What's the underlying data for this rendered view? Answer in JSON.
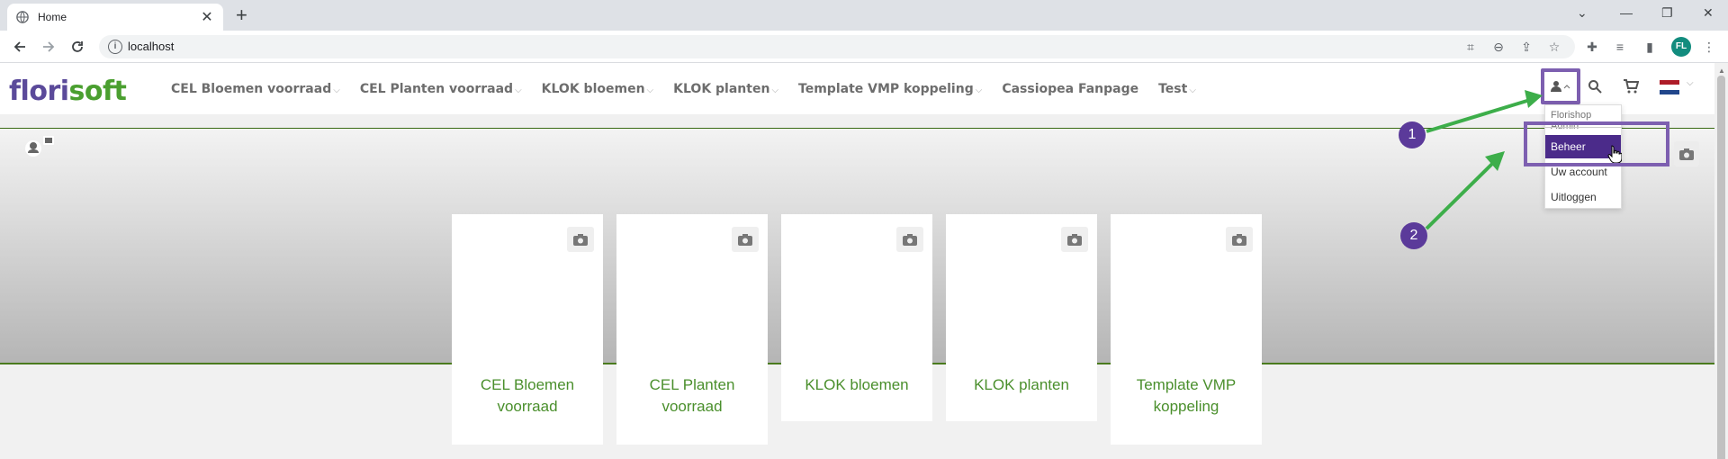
{
  "browser": {
    "tab_title": "Home",
    "tab_close": "✕",
    "new_tab": "+",
    "url": "localhost",
    "profile_initials": "FL",
    "window_controls": [
      "⌄",
      "—",
      "❐",
      "✕"
    ]
  },
  "site": {
    "logo_flori": "flori",
    "logo_soft": "soft",
    "menu": [
      {
        "label": "CEL Bloemen voorraad",
        "has_dropdown": true
      },
      {
        "label": "CEL Planten voorraad",
        "has_dropdown": true
      },
      {
        "label": "KLOK bloemen",
        "has_dropdown": true
      },
      {
        "label": "KLOK planten",
        "has_dropdown": true
      },
      {
        "label": "Template VMP koppeling",
        "has_dropdown": true
      },
      {
        "label": "Cassiopea Fanpage",
        "has_dropdown": false
      },
      {
        "label": "Test",
        "has_dropdown": true
      }
    ],
    "chevron": "⌵"
  },
  "user_menu": {
    "user_name": "Florishop Admin",
    "items": [
      "Beheer",
      "Uw account",
      "Uitloggen"
    ]
  },
  "cards": [
    {
      "label": "CEL Bloemen voorraad"
    },
    {
      "label": "CEL Planten voorraad"
    },
    {
      "label": "KLOK bloemen"
    },
    {
      "label": "KLOK planten"
    },
    {
      "label": "Template VMP koppeling"
    }
  ],
  "annotations": {
    "badge_1": "1",
    "badge_2": "2",
    "arrow_color": "#3dae4a",
    "highlight_color": "#7d5fb0"
  },
  "colors": {
    "brand_purple": "#5b4a9a",
    "brand_green": "#4a9f2f",
    "selected_bg": "#4b2b8a"
  }
}
